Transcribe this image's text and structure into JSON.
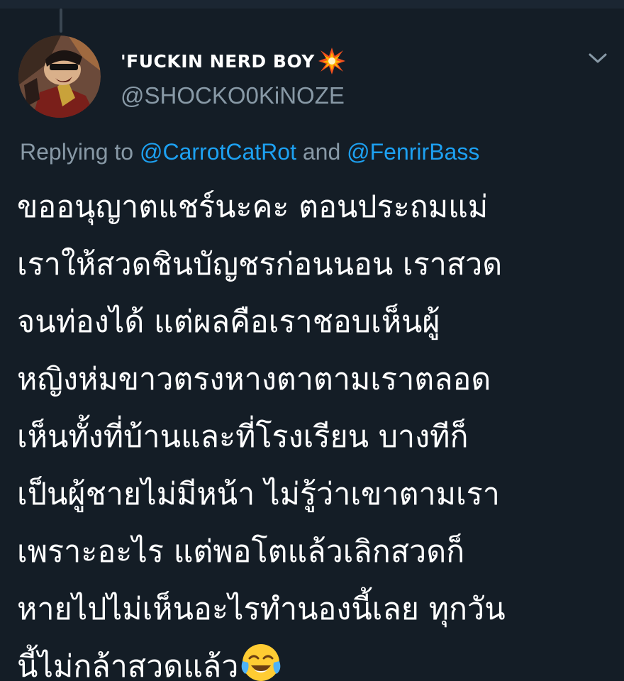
{
  "tweet": {
    "author": {
      "display_name": "'FUCKIN NERD BOY",
      "name_emoji": "collision-emoji",
      "handle": "@SHOCKO0KiNOZE",
      "avatar": "comic-character-avatar"
    },
    "menu_icon": "chevron-down-icon",
    "replying_to": {
      "prefix": "Replying to ",
      "mention_1": "@CarrotCatRot",
      "conjunction": " and ",
      "mention_2": "@FenrirBass"
    },
    "body_lines": [
      "ขออนุญาตแชร์นะคะ ตอนประถมแม่",
      "เราให้สวดชินบัญชรก่อนนอน เราสวด",
      "จนท่องได้ แต่ผลคือเราชอบเห็นผู้",
      "หญิงห่มขาวตรงหางตาตามเราตลอด",
      "เห็นทั้งที่บ้านและที่โรงเรียน บางทีก็",
      "เป็นผู้ชายไม่มีหน้า ไม่รู้ว่าเขาตามเรา",
      "เพราะอะไร แต่พอโตแล้วเลิกสวดก็",
      "หายไปไม่เห็นอะไรทำนองนี้เลย ทุกวัน",
      "นี้ไม่กล้าสวดแล้ว"
    ],
    "end_emoji": "face-with-tears-of-joy-emoji"
  },
  "colors": {
    "background": "#141d26",
    "text_primary": "#ffffff",
    "text_secondary": "#8899a6",
    "link": "#1da1f2"
  }
}
